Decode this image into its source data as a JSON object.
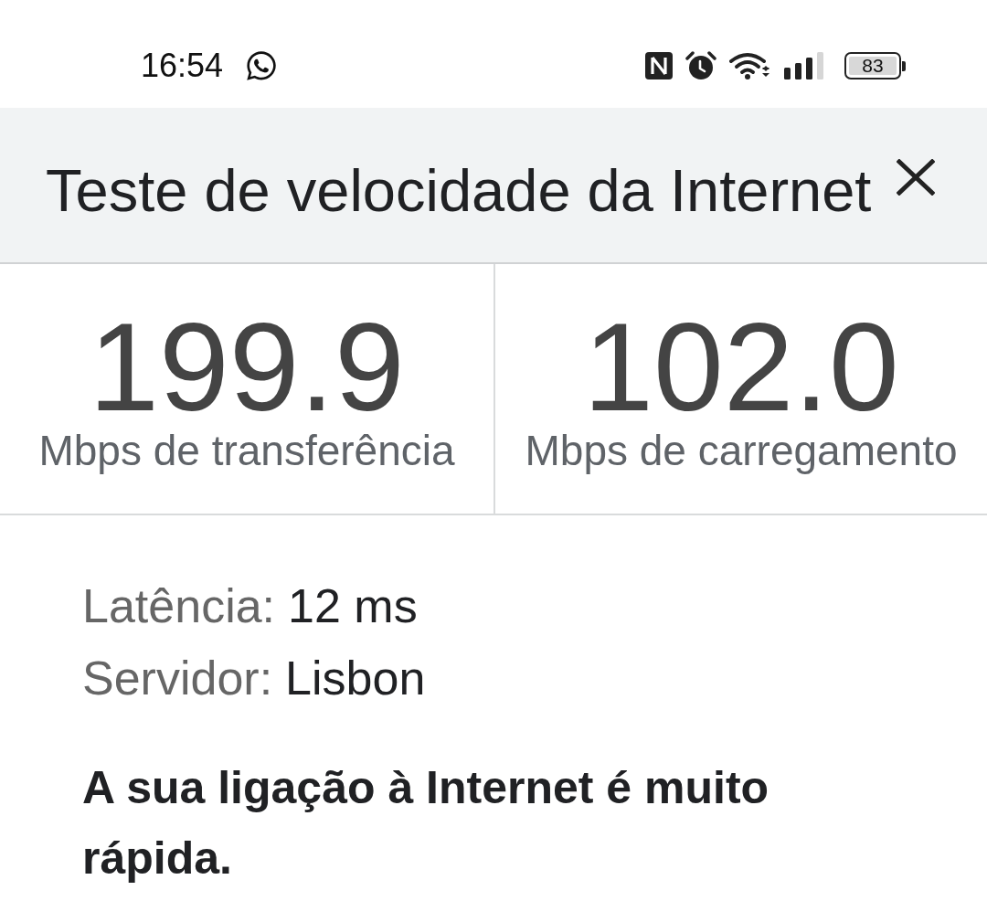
{
  "status_bar": {
    "time": "16:54",
    "battery": "83"
  },
  "header": {
    "title": "Teste de velocidade da Internet"
  },
  "results": [
    {
      "value": "199.9",
      "label": "Mbps de transferência"
    },
    {
      "value": "102.0",
      "label": "Mbps de carregamento"
    }
  ],
  "details": [
    {
      "label": "Latência:",
      "value": "12 ms"
    },
    {
      "label": "Servidor:",
      "value": "Lisbon"
    }
  ],
  "summary": "A sua ligação à Internet é muito rápida."
}
